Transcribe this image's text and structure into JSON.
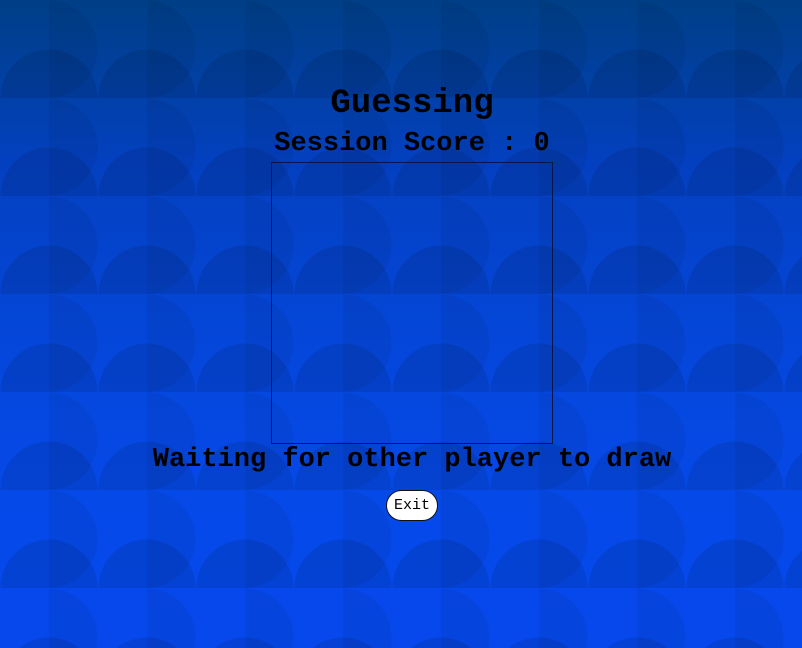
{
  "page": {
    "title": "Guessing",
    "score_label": "Session Score : 0",
    "status": "Waiting for other player to draw",
    "exit_label": "Exit"
  },
  "colors": {
    "background_top": "#003f86",
    "background_bottom": "#0648ec",
    "text": "#000000",
    "canvas_border": "#06164a",
    "button_bg": "#ffffff"
  }
}
